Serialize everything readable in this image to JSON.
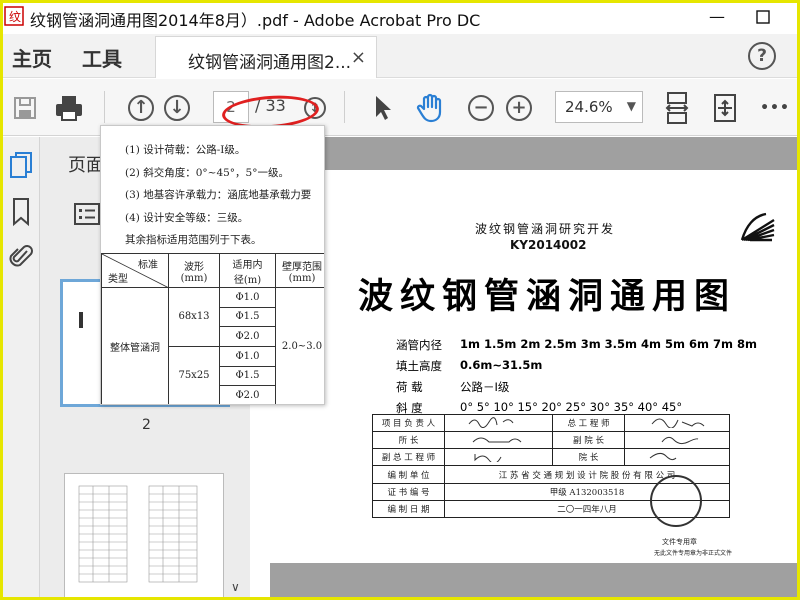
{
  "window": {
    "title": "纹钢管涵洞通用图2014年8月）.pdf - Adobe Acrobat Pro DC",
    "minimize_glyph": "—",
    "maximize_glyph": "☐"
  },
  "nav": {
    "home": "主页",
    "tools": "工具",
    "doc_tab": "纹钢管涵洞通用图2...",
    "close_glyph": "×",
    "help_glyph": "?"
  },
  "toolbar": {
    "current_page": "2",
    "page_total": "/ 33",
    "zoom": "24.6%",
    "more_glyph": "•••",
    "icons": [
      "save-icon",
      "print-icon",
      "prev-page-icon",
      "next-page-icon",
      "scroll-icon",
      "select-arrow-icon",
      "hand-icon",
      "zoom-out-icon",
      "zoom-in-icon",
      "fit-page-icon",
      "page-view-icon",
      "more-icon"
    ]
  },
  "panel": {
    "title": "页面",
    "thumb2_label": "2",
    "rail_icons": [
      "pages-icon",
      "bookmark-icon",
      "attachment-icon"
    ]
  },
  "popup": {
    "lines": [
      "(1) 设计荷载：公路-Ⅰ级。",
      "(2) 斜交角度：0°~45°，5°一级。",
      "(3) 地基容许承载力：涵底地基承载力要",
      "(4) 设计安全等级：三级。",
      "其余指标适用范围列于下表。"
    ],
    "table": {
      "h_standard": "标准",
      "h_type": "类型",
      "h_wave": "波形",
      "h_wave_unit": "(mm)",
      "h_diam": "适用内",
      "h_diam_unit": "径(m)",
      "h_wall": "壁厚范围",
      "h_wall_unit": "(mm)",
      "type": "整体管涵洞",
      "wave1": "68x13",
      "wave2": "75x25",
      "diam": [
        "Φ1.0",
        "Φ1.5",
        "Φ2.0",
        "Φ1.0",
        "Φ1.5",
        "Φ2.0"
      ],
      "wall": "2.0~3.0"
    }
  },
  "document": {
    "subtitle": "波纹钢管涵洞研究开发",
    "code": "KY2014002",
    "title": "波纹钢管涵洞通用图",
    "specs": [
      {
        "k": "涵管内径",
        "v": "1m 1.5m 2m 2.5m 3m 3.5m 4m 5m 6m 7m 8m"
      },
      {
        "k": "填土高度",
        "v": "0.6m~31.5m"
      },
      {
        "k": "荷      载",
        "v": "公路－Ⅰ级"
      },
      {
        "k": "斜      度",
        "v": "0°  5°  10°  15°  20°  25°  30°  35°  40°  45°"
      }
    ],
    "sig": {
      "r1a": "项 目 负 责 人",
      "r1b": "总 工 程 师",
      "r2a": "所          长",
      "r2b": "副    院    长",
      "r3a": "副 总 工 程 师",
      "r3b": "院          长",
      "r4a": "编  制  单  位",
      "r4b": "江 苏 省 交 通 规 划 设 计 院 股 份 有 限 公 司",
      "r5a": "证  书  编  号",
      "r5b": "甲级 A132003518",
      "r6a": "编  制  日  期",
      "r6b": "二〇一四年八月"
    },
    "seal_text": "文件专用章",
    "seal_text2": "无此文件专用章为非正式文件"
  },
  "colors": {
    "accent_blue": "#2a7fd4",
    "annotation_red": "#e02020",
    "frame_yellow": "#e6e600"
  }
}
